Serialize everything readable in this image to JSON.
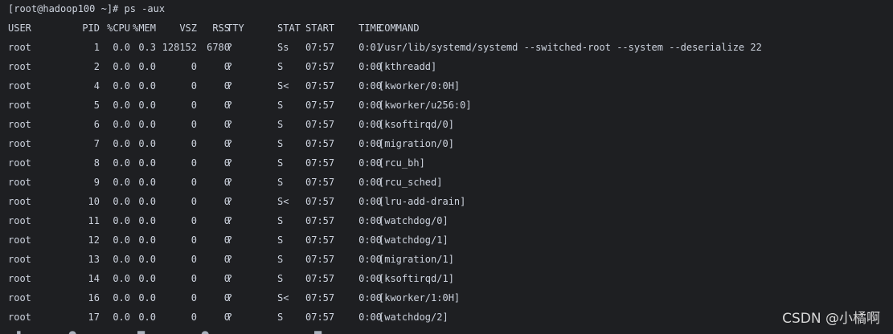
{
  "terminal": {
    "prompt": "[root@hadoop100 ~]# ps -aux",
    "headers": {
      "user": "USER",
      "pid": "PID",
      "cpu": "%CPU",
      "mem": "%MEM",
      "vsz": "VSZ",
      "rss": "RSS",
      "tty": "TTY",
      "stat": "STAT",
      "start": "START",
      "time": "TIME",
      "command": "COMMAND"
    },
    "processes": [
      {
        "user": "root",
        "pid": "1",
        "cpu": "0.0",
        "mem": "0.3",
        "vsz": "128152",
        "rss": "6780",
        "tty": "?",
        "stat": "Ss",
        "start": "07:57",
        "time": "0:01",
        "command": "/usr/lib/systemd/systemd --switched-root --system --deserialize 22"
      },
      {
        "user": "root",
        "pid": "2",
        "cpu": "0.0",
        "mem": "0.0",
        "vsz": "0",
        "rss": "0",
        "tty": "?",
        "stat": "S",
        "start": "07:57",
        "time": "0:00",
        "command": "[kthreadd]"
      },
      {
        "user": "root",
        "pid": "4",
        "cpu": "0.0",
        "mem": "0.0",
        "vsz": "0",
        "rss": "0",
        "tty": "?",
        "stat": "S<",
        "start": "07:57",
        "time": "0:00",
        "command": "[kworker/0:0H]"
      },
      {
        "user": "root",
        "pid": "5",
        "cpu": "0.0",
        "mem": "0.0",
        "vsz": "0",
        "rss": "0",
        "tty": "?",
        "stat": "S",
        "start": "07:57",
        "time": "0:00",
        "command": "[kworker/u256:0]"
      },
      {
        "user": "root",
        "pid": "6",
        "cpu": "0.0",
        "mem": "0.0",
        "vsz": "0",
        "rss": "0",
        "tty": "?",
        "stat": "S",
        "start": "07:57",
        "time": "0:00",
        "command": "[ksoftirqd/0]"
      },
      {
        "user": "root",
        "pid": "7",
        "cpu": "0.0",
        "mem": "0.0",
        "vsz": "0",
        "rss": "0",
        "tty": "?",
        "stat": "S",
        "start": "07:57",
        "time": "0:00",
        "command": "[migration/0]"
      },
      {
        "user": "root",
        "pid": "8",
        "cpu": "0.0",
        "mem": "0.0",
        "vsz": "0",
        "rss": "0",
        "tty": "?",
        "stat": "S",
        "start": "07:57",
        "time": "0:00",
        "command": "[rcu_bh]"
      },
      {
        "user": "root",
        "pid": "9",
        "cpu": "0.0",
        "mem": "0.0",
        "vsz": "0",
        "rss": "0",
        "tty": "?",
        "stat": "S",
        "start": "07:57",
        "time": "0:00",
        "command": "[rcu_sched]"
      },
      {
        "user": "root",
        "pid": "10",
        "cpu": "0.0",
        "mem": "0.0",
        "vsz": "0",
        "rss": "0",
        "tty": "?",
        "stat": "S<",
        "start": "07:57",
        "time": "0:00",
        "command": "[lru-add-drain]"
      },
      {
        "user": "root",
        "pid": "11",
        "cpu": "0.0",
        "mem": "0.0",
        "vsz": "0",
        "rss": "0",
        "tty": "?",
        "stat": "S",
        "start": "07:57",
        "time": "0:00",
        "command": "[watchdog/0]"
      },
      {
        "user": "root",
        "pid": "12",
        "cpu": "0.0",
        "mem": "0.0",
        "vsz": "0",
        "rss": "0",
        "tty": "?",
        "stat": "S",
        "start": "07:57",
        "time": "0:00",
        "command": "[watchdog/1]"
      },
      {
        "user": "root",
        "pid": "13",
        "cpu": "0.0",
        "mem": "0.0",
        "vsz": "0",
        "rss": "0",
        "tty": "?",
        "stat": "S",
        "start": "07:57",
        "time": "0:00",
        "command": "[migration/1]"
      },
      {
        "user": "root",
        "pid": "14",
        "cpu": "0.0",
        "mem": "0.0",
        "vsz": "0",
        "rss": "0",
        "tty": "?",
        "stat": "S",
        "start": "07:57",
        "time": "0:00",
        "command": "[ksoftirqd/1]"
      },
      {
        "user": "root",
        "pid": "16",
        "cpu": "0.0",
        "mem": "0.0",
        "vsz": "0",
        "rss": "0",
        "tty": "?",
        "stat": "S<",
        "start": "07:57",
        "time": "0:00",
        "command": "[kworker/1:0H]"
      },
      {
        "user": "root",
        "pid": "17",
        "cpu": "0.0",
        "mem": "0.0",
        "vsz": "0",
        "rss": "0",
        "tty": "?",
        "stat": "S",
        "start": "07:57",
        "time": "0:00",
        "command": "[watchdog/2]"
      }
    ]
  },
  "watermark": "CSDN @小橘啊",
  "colors": {
    "background": "#1e1f22",
    "text": "#cdd3de"
  }
}
